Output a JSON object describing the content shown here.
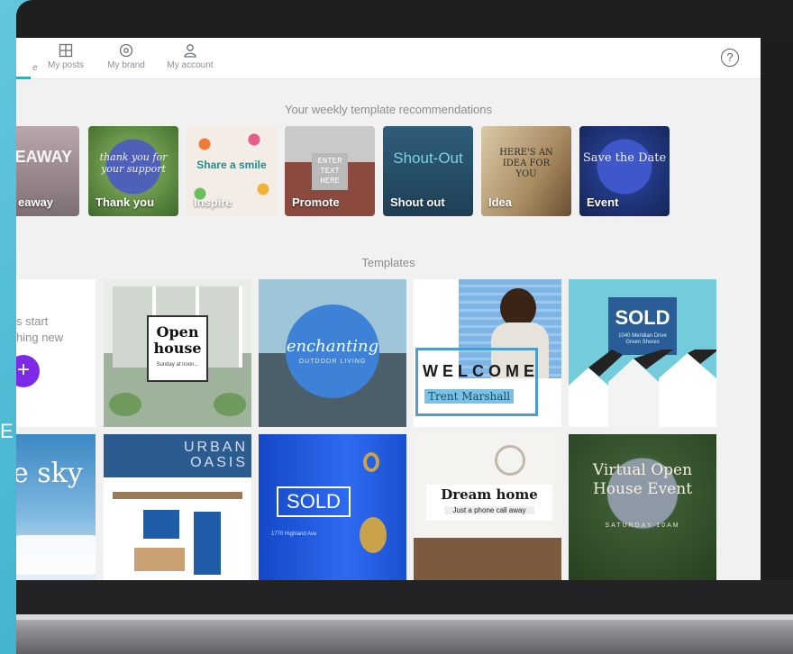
{
  "left_edge": {
    "partial_letter": "E"
  },
  "nav": {
    "items": [
      {
        "label": "Home",
        "visible": "e"
      },
      {
        "label": "My posts"
      },
      {
        "label": "My brand"
      },
      {
        "label": "My account"
      }
    ],
    "help_glyph": "?"
  },
  "recommendations": {
    "title": "Your weekly template recommendations",
    "tiles": [
      {
        "label": "Giveaway",
        "visible": "eaway",
        "art": "VEAWAY"
      },
      {
        "label": "Thank you",
        "art": "thank you for your support"
      },
      {
        "label": "Inspire",
        "art": "Share a smile"
      },
      {
        "label": "Promote",
        "art": "ENTER TEXT HERE"
      },
      {
        "label": "Shout out",
        "art": "Shout-Out"
      },
      {
        "label": "Idea",
        "art": "HERE'S AN IDEA FOR YOU"
      },
      {
        "label": "Event",
        "art": "Save the Date"
      }
    ]
  },
  "templates": {
    "title": "Templates",
    "start_tile": {
      "line1": "s start",
      "line2": "hing new",
      "plus": "+"
    },
    "tiles": [
      {
        "title": "Open house",
        "sub": "Sunday at noon..."
      },
      {
        "title": "enchanting",
        "sub": "OUTDOOR LIVING"
      },
      {
        "title": "WELCOME",
        "sub": "Trent Marshall"
      },
      {
        "title": "SOLD",
        "sub": "1040 Meridian Drive Green Shores"
      },
      {
        "title": "e sky"
      },
      {
        "title": "URBAN OASIS"
      },
      {
        "title": "SOLD",
        "sub": "1770 Highland Ave"
      },
      {
        "title": "Dream home",
        "sub": "Just a phone call away"
      },
      {
        "title": "Virtual Open House Event",
        "sub": "SATURDAY 10AM"
      }
    ]
  },
  "colors": {
    "accent": "#00c4cc",
    "purple": "#7d2ae8",
    "teal_bg": "#3aaecb"
  }
}
